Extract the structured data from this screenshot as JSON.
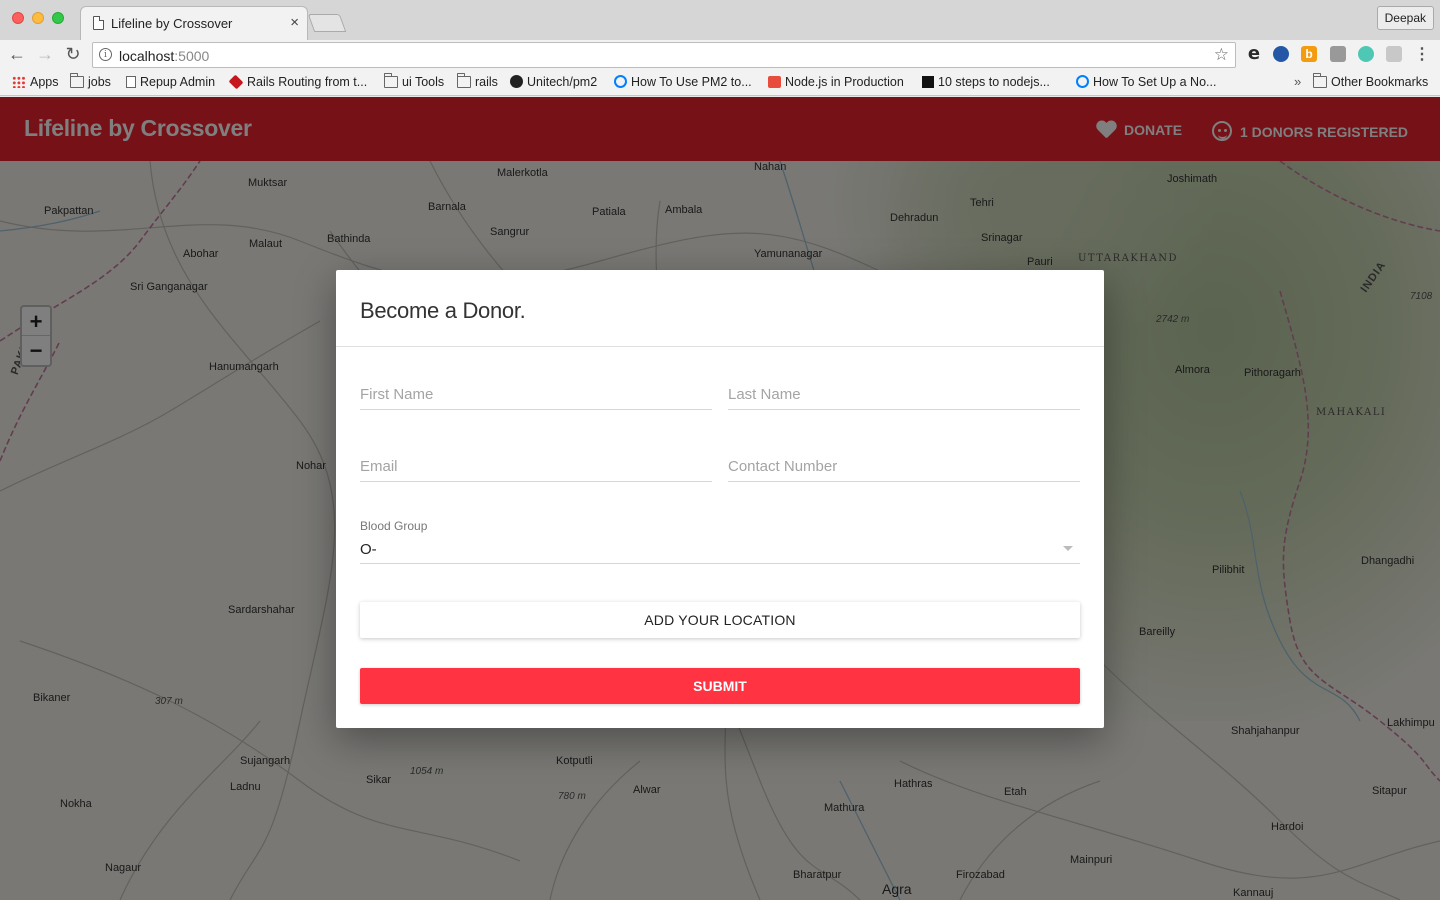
{
  "browser": {
    "tab_title": "Lifeline by Crossover",
    "tab_close": "×",
    "profile_name": "Deepak",
    "url_host": "localhost",
    "url_port": ":5000",
    "bookmarks": [
      {
        "label": "Apps",
        "icon": "apps-grid-icon"
      },
      {
        "label": "jobs",
        "icon": "folder-icon"
      },
      {
        "label": "Repup Admin",
        "icon": "page-icon"
      },
      {
        "label": "Rails Routing from t...",
        "icon": "ruby-icon"
      },
      {
        "label": "ui Tools",
        "icon": "folder-icon"
      },
      {
        "label": "rails",
        "icon": "folder-icon"
      },
      {
        "label": "Unitech/pm2",
        "icon": "github-icon"
      },
      {
        "label": "How To Use PM2 to...",
        "icon": "digitalocean-icon"
      },
      {
        "label": "Node.js in Production",
        "icon": "node-icon"
      },
      {
        "label": "10 steps to nodejs...",
        "icon": "terminal-icon"
      },
      {
        "label": "How To Set Up a No...",
        "icon": "digitalocean-icon"
      }
    ],
    "bookmarks_more": "»",
    "other_bookmarks": "Other Bookmarks"
  },
  "app": {
    "brand": "Lifeline by Crossover",
    "nav_donate": "DONATE",
    "nav_donors": "1 DONORS REGISTERED",
    "accent_color": "#ed2230"
  },
  "map": {
    "zoom_in": "+",
    "zoom_out": "−",
    "places": [
      "Muktsar",
      "Malerkotla",
      "Nahan",
      "Joshimath",
      "Pakpattan",
      "Barnala",
      "Patiala",
      "Ambala",
      "Dehradun",
      "Tehri",
      "Malaut",
      "Bathinda",
      "Sangrur",
      "Srinagar",
      "Abohar",
      "Yamunanagar",
      "Pauri",
      "UTTARAKHAND",
      "Sri Ganganagar",
      "INDIA",
      "PAKISTAN",
      "2742 m",
      "Hanumangarh",
      "Almora",
      "Pithoragarh",
      "MAHAKALI",
      "Nohar",
      "Pilibhit",
      "Dhangadhi",
      "Sardarshahar",
      "Bareilly",
      "Bikaner",
      "307 m",
      "Shahjahanpur",
      "Lakhimpu",
      "Sujangarh",
      "Kotputli",
      "Sikar",
      "1054 m",
      "Ladnu",
      "Alwar",
      "Hathras",
      "Etah",
      "Sitapur",
      "780 m",
      "Nokha",
      "Mathura",
      "Hardoi",
      "Mainpuri",
      "Nagaur",
      "Bharatpur",
      "Agra",
      "Firozabad",
      "Kannauj",
      "7108"
    ]
  },
  "modal": {
    "title": "Become a Donor.",
    "first_name_placeholder": "First Name",
    "last_name_placeholder": "Last Name",
    "email_placeholder": "Email",
    "contact_placeholder": "Contact Number",
    "blood_group_label": "Blood Group",
    "blood_group_value": "O-",
    "location_button": "ADD YOUR LOCATION",
    "submit_button": "SUBMIT",
    "submit_color": "#ff3341"
  }
}
